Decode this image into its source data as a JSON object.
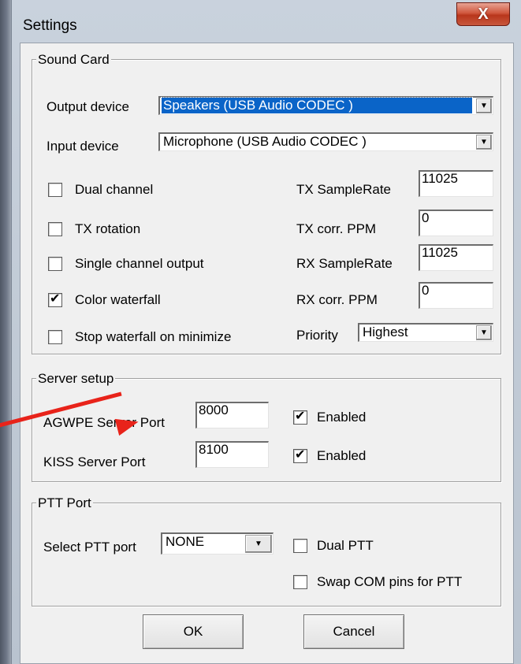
{
  "window": {
    "title": "Settings",
    "close_glyph": "X"
  },
  "sound_card": {
    "title": "Sound Card",
    "output_device_label": "Output device",
    "output_device_value": "Speakers (USB Audio CODEC )",
    "input_device_label": "Input device",
    "input_device_value": "Microphone (USB Audio CODEC )",
    "dual_channel": {
      "label": "Dual channel",
      "checked": false
    },
    "tx_rotation": {
      "label": "TX rotation",
      "checked": false
    },
    "single_channel_output": {
      "label": "Single channel output",
      "checked": false
    },
    "color_waterfall": {
      "label": "Color waterfall",
      "checked": true
    },
    "stop_waterfall": {
      "label": "Stop waterfall on minimize",
      "checked": false
    },
    "tx_samplerate_label": "TX SampleRate",
    "tx_samplerate_value": "11025",
    "tx_corr_label": "TX corr. PPM",
    "tx_corr_value": "0",
    "rx_samplerate_label": "RX SampleRate",
    "rx_samplerate_value": "11025",
    "rx_corr_label": "RX corr. PPM",
    "rx_corr_value": "0",
    "priority_label": "Priority",
    "priority_value": "Highest"
  },
  "server_setup": {
    "title": "Server setup",
    "agwpe_label": "AGWPE Server Port",
    "agwpe_value": "8000",
    "agwpe_enabled": {
      "label": "Enabled",
      "checked": true
    },
    "kiss_label": "KISS Server Port",
    "kiss_value": "8100",
    "kiss_enabled": {
      "label": "Enabled",
      "checked": true
    }
  },
  "ptt_port": {
    "title": "PTT Port",
    "select_label": "Select PTT port",
    "select_value": "NONE",
    "dual_ptt": {
      "label": "Dual PTT",
      "checked": false
    },
    "swap_com": {
      "label": "Swap COM pins for PTT",
      "checked": false
    }
  },
  "buttons": {
    "ok": "OK",
    "cancel": "Cancel"
  },
  "check_glyph": "✔",
  "dropdown_glyph": "▼",
  "colors": {
    "annotation_arrow": "#e8231a",
    "selection": "#0a64c8",
    "close_button": "#c8452b"
  }
}
